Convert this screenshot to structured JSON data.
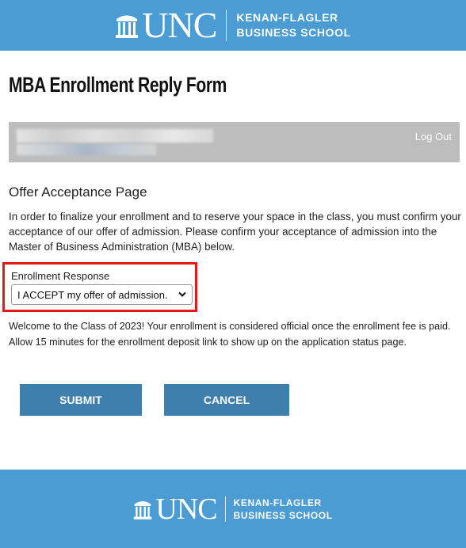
{
  "header": {
    "logo_text": "UNC",
    "school_line1": "KENAN-FLAGLER",
    "school_line2": "BUSINESS SCHOOL"
  },
  "page": {
    "title": "MBA Enrollment Reply Form"
  },
  "user_bar": {
    "logout_label": "Log Out"
  },
  "content": {
    "section_title": "Offer Acceptance Page",
    "intro": "In order to finalize your enrollment and to reserve your space in the class, you must confirm your acceptance of our offer of admission.  Please confirm your acceptance of admission into the Master of Business Administration (MBA) below.",
    "response_label": "Enrollment Response",
    "response_value": "I ACCEPT my offer of admission.",
    "welcome": "Welcome to the Class of 2023! Your enrollment is considered official once the enrollment fee is paid. Allow 15 minutes for the enrollment deposit link to show up on the application status page."
  },
  "buttons": {
    "submit": "SUBMIT",
    "cancel": "CANCEL"
  },
  "footer": {
    "logo_text": "UNC",
    "school_line1": "KENAN-FLAGLER",
    "school_line2": "BUSINESS SCHOOL"
  },
  "colors": {
    "brand_blue": "#4b9cd3",
    "button_blue": "#3f7fae",
    "highlight_red": "#e21a1a",
    "user_bar_gray": "#bdbdbd"
  }
}
